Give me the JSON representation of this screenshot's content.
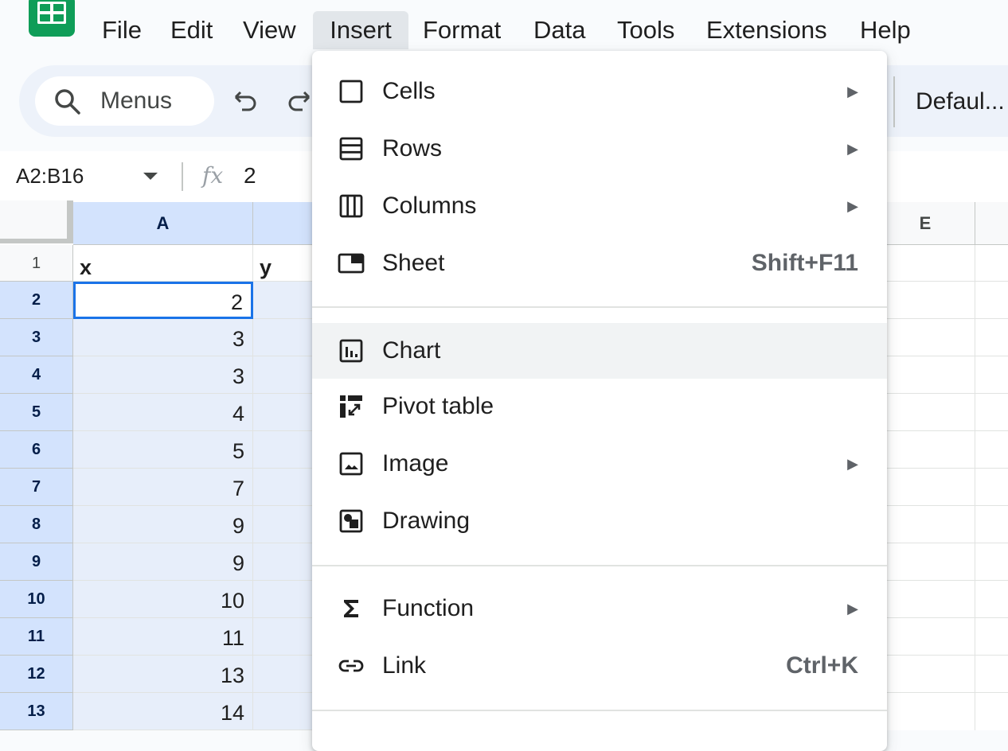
{
  "menubar": {
    "items": [
      "File",
      "Edit",
      "View",
      "Insert",
      "Format",
      "Data",
      "Tools",
      "Extensions",
      "Help"
    ],
    "active": "Insert"
  },
  "toolbar": {
    "search_label": "Menus",
    "font": "Defaul..."
  },
  "formula_bar": {
    "name_box": "A2:B16",
    "fx": "fx",
    "value": "2"
  },
  "grid": {
    "columns": [
      "A",
      "",
      "",
      "",
      "E",
      ""
    ],
    "header_row": {
      "num": "1",
      "a": "x",
      "b": "y"
    },
    "rows": [
      {
        "num": "2",
        "a": "2"
      },
      {
        "num": "3",
        "a": "3"
      },
      {
        "num": "4",
        "a": "3"
      },
      {
        "num": "5",
        "a": "4"
      },
      {
        "num": "6",
        "a": "5"
      },
      {
        "num": "7",
        "a": "7"
      },
      {
        "num": "8",
        "a": "9"
      },
      {
        "num": "9",
        "a": "9"
      },
      {
        "num": "10",
        "a": "10"
      },
      {
        "num": "11",
        "a": "11"
      },
      {
        "num": "12",
        "a": "13"
      },
      {
        "num": "13",
        "a": "14"
      }
    ]
  },
  "insert_menu": {
    "items": [
      {
        "label": "Cells",
        "submenu": true,
        "icon": "cells-icon"
      },
      {
        "label": "Rows",
        "submenu": true,
        "icon": "rows-icon"
      },
      {
        "label": "Columns",
        "submenu": true,
        "icon": "columns-icon"
      },
      {
        "label": "Sheet",
        "shortcut": "Shift+F11",
        "icon": "sheet-icon"
      },
      {
        "label": "Chart",
        "highlighted": true,
        "icon": "chart-icon"
      },
      {
        "label": "Pivot table",
        "icon": "pivot-table-icon"
      },
      {
        "label": "Image",
        "submenu": true,
        "icon": "image-icon"
      },
      {
        "label": "Drawing",
        "icon": "drawing-icon"
      },
      {
        "label": "Function",
        "submenu": true,
        "icon": "sigma-icon"
      },
      {
        "label": "Link",
        "shortcut": "Ctrl+K",
        "icon": "link-icon"
      }
    ],
    "submenu_arrow": "▶"
  },
  "colors": {
    "brand": "#0f9d58",
    "selection": "#d3e3fd",
    "active_border": "#1a73e8"
  }
}
